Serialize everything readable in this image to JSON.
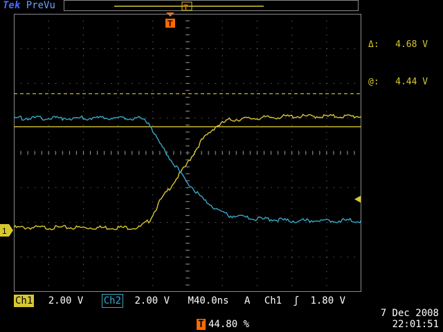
{
  "header": {
    "brand": "Tek",
    "mode": "PreVu"
  },
  "cursor": {
    "delta_label": "Δ:",
    "delta_value": "4.68 V",
    "at_label": "@:",
    "at_value": "4.44 V"
  },
  "markers": {
    "channel1": "1",
    "trigger": "T"
  },
  "footer": {
    "ch1_label": "Ch1",
    "ch1_scale": "2.00 V",
    "ch2_label": "Ch2",
    "ch2_scale": "2.00 V",
    "timebase_label": "M",
    "timebase": "40.0ns",
    "trigger_mode": "A",
    "trigger_source": "Ch1",
    "trigger_slope": "ʃ",
    "trigger_level": "1.80 V",
    "trigger_position": "44.80 %",
    "date": "7 Dec 2008",
    "time": "22:01:51"
  },
  "colors": {
    "ch1": "#d8c830",
    "ch2": "#3aa8c8",
    "trigger": "#ff6a00",
    "grid": "#8a8a8a"
  },
  "chart_data": {
    "type": "line",
    "x_divisions": 10,
    "y_divisions": 8,
    "series": [
      {
        "x": [
          0,
          3.6,
          3.9,
          4.2,
          4.6,
          5.0,
          5.4,
          5.8,
          6.2,
          7.0,
          8.0,
          10.0
        ],
        "y": [
          -2.15,
          -2.15,
          -1.95,
          -1.4,
          -0.85,
          -0.3,
          0.35,
          0.75,
          0.95,
          1.0,
          1.05,
          1.05
        ]
      },
      {
        "x": [
          0,
          3.6,
          3.9,
          4.2,
          4.6,
          5.0,
          5.4,
          5.8,
          6.2,
          7.0,
          8.0,
          10.0
        ],
        "y": [
          1.0,
          1.0,
          0.85,
          0.25,
          -0.3,
          -0.85,
          -1.3,
          -1.6,
          -1.8,
          -1.9,
          -1.95,
          -1.95
        ]
      }
    ],
    "ref_lines": [
      1.7,
      0.75
    ]
  }
}
